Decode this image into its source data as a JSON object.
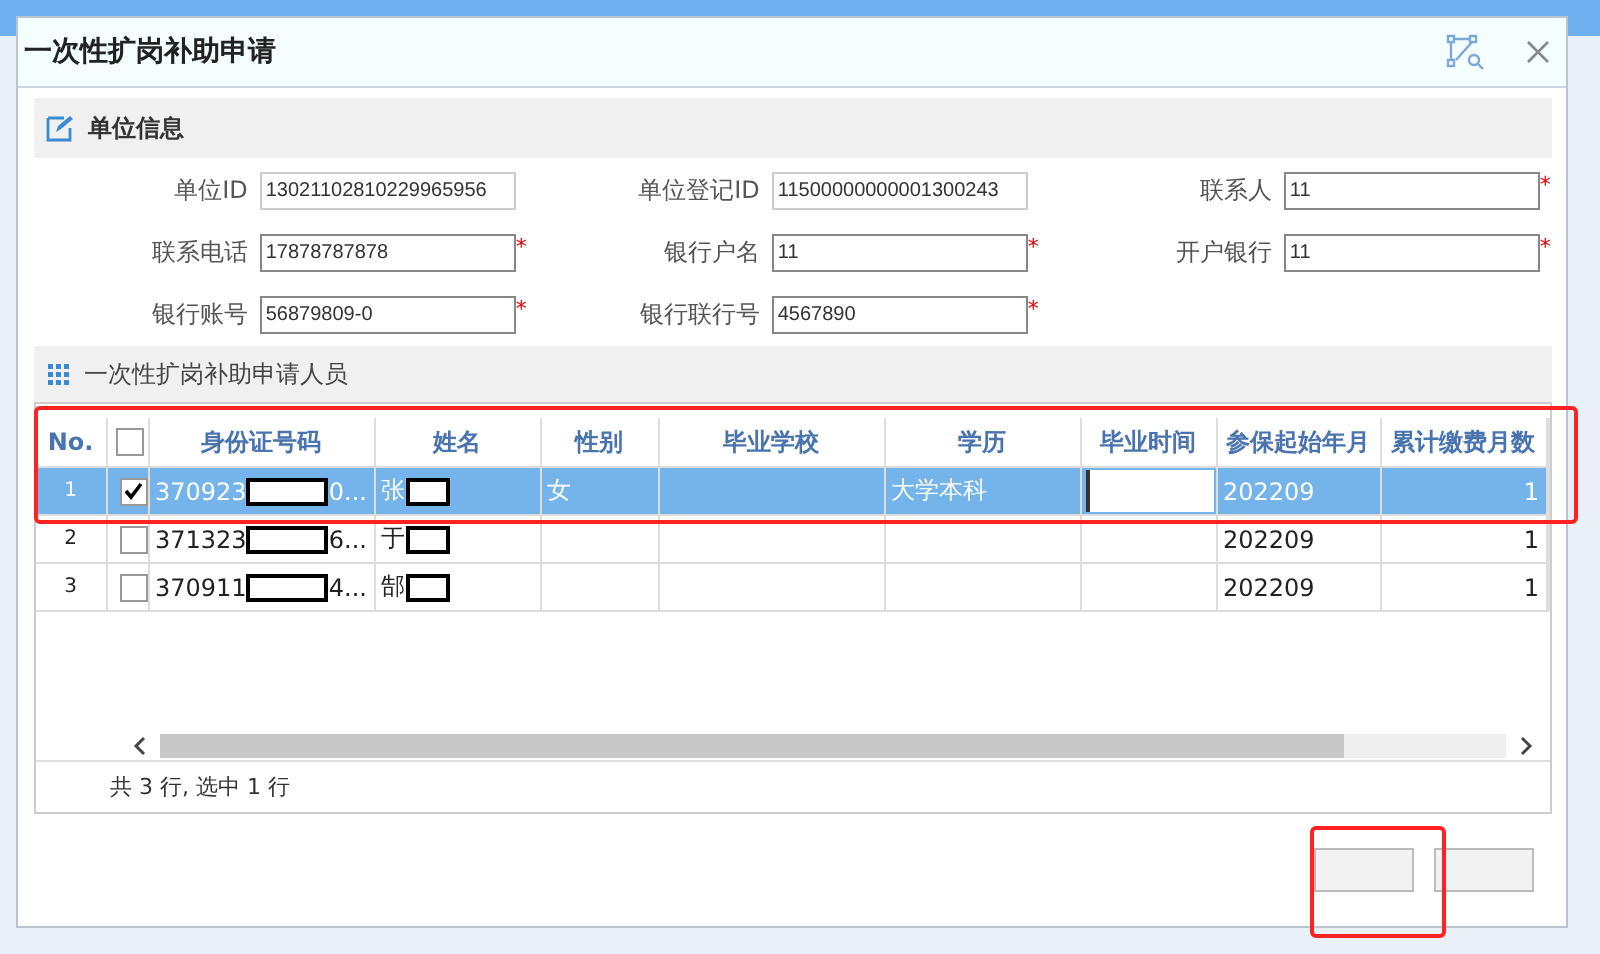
{
  "window": {
    "title": "一次性扩岗补助申请"
  },
  "unit_section": {
    "title": "单位信息",
    "fields": [
      {
        "label": "单位ID",
        "value": "13021102810229965956",
        "editable": false
      },
      {
        "label": "单位登记ID",
        "value": "11500000000001300243",
        "editable": false
      },
      {
        "label": "联系人",
        "value": "11",
        "required_mark": "*",
        "editable": true
      },
      {
        "label": "联系电话",
        "value": "17878787878",
        "required_mark": "*",
        "editable": true
      },
      {
        "label": "银行户名",
        "value": "11",
        "required_mark": "*",
        "editable": true
      },
      {
        "label": "开户银行",
        "value": "11",
        "required_mark": "*",
        "editable": true
      },
      {
        "label": "银行账号",
        "value": "56879809-0",
        "required_mark": "*",
        "editable": true
      },
      {
        "label": "银行联行号",
        "value": "4567890",
        "required_mark": "*",
        "editable": true
      }
    ]
  },
  "grid_section": {
    "title": "一次性扩岗补助申请人员",
    "columns": [
      "No.",
      "身份证号码",
      "姓名",
      "性别",
      "毕业学校",
      "学历",
      "毕业时间",
      "参保起始年月",
      "累计缴费月数"
    ],
    "header_checked": false,
    "rows": [
      {
        "no": "1",
        "selected": true,
        "checked": true,
        "id_start": "370923",
        "id_end": "0...",
        "name_start": "张",
        "sex": "女",
        "school": "",
        "education": "大学本科",
        "grad_time": "",
        "grad_time_editing": true,
        "start": "202209",
        "months": "1"
      },
      {
        "no": "2",
        "selected": false,
        "checked": false,
        "id_start": "371323",
        "id_end": "6...",
        "name_start": "于",
        "sex": "",
        "school": "",
        "education": "",
        "grad_time": "",
        "grad_time_editing": false,
        "start": "202209",
        "months": "1"
      },
      {
        "no": "3",
        "selected": false,
        "checked": false,
        "id_start": "370911",
        "id_end": "4...",
        "name_start": "郜",
        "sex": "",
        "school": "",
        "education": "",
        "grad_time": "",
        "grad_time_editing": false,
        "start": "202209",
        "months": "1"
      }
    ],
    "summary": "共 3 行, 选中 1 行"
  }
}
